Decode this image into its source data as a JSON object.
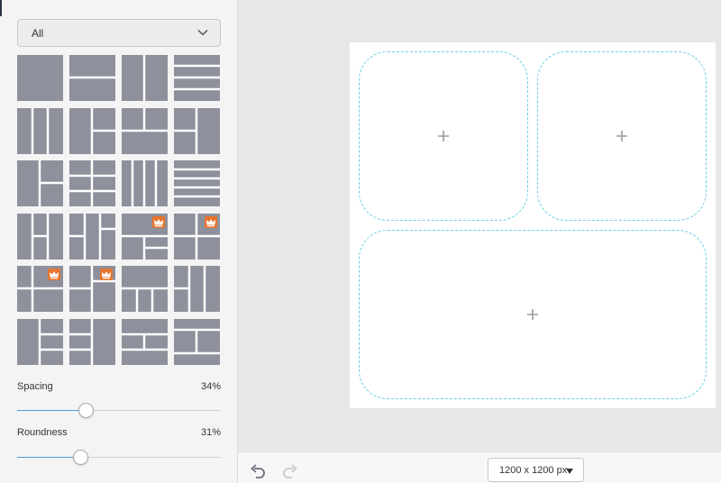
{
  "filter": {
    "selected": "All",
    "icon": "chevron-down-icon"
  },
  "layouts": [
    {
      "id": "single",
      "premium": false
    },
    {
      "id": "two-rows",
      "premium": false
    },
    {
      "id": "two-columns",
      "premium": false
    },
    {
      "id": "four-rows",
      "premium": false
    },
    {
      "id": "three-columns",
      "premium": false
    },
    {
      "id": "grid-2x2-wide-left",
      "premium": false
    },
    {
      "id": "top-split-bottom-wide",
      "premium": false
    },
    {
      "id": "left-stack-right-tall",
      "premium": false
    },
    {
      "id": "left-tall-right-stack",
      "premium": false
    },
    {
      "id": "grid-2x3",
      "premium": false
    },
    {
      "id": "four-columns",
      "premium": false
    },
    {
      "id": "five-rows",
      "premium": false
    },
    {
      "id": "columns-mixed-a",
      "premium": false
    },
    {
      "id": "columns-mixed-b",
      "premium": false
    },
    {
      "id": "top-wide-bottom-grid",
      "premium": true
    },
    {
      "id": "top-split-bottom-stack",
      "premium": true
    },
    {
      "id": "left-column-grid",
      "premium": true
    },
    {
      "id": "mixed-grid",
      "premium": true
    },
    {
      "id": "top-wide-three-bottom",
      "premium": false
    },
    {
      "id": "tall-left-grid",
      "premium": false
    },
    {
      "id": "left-tall-rows",
      "premium": false
    },
    {
      "id": "column-rows-mixed",
      "premium": false
    },
    {
      "id": "rows-split",
      "premium": false
    },
    {
      "id": "rows-grid",
      "premium": false
    }
  ],
  "premium_icon": "crown-icon",
  "spacing": {
    "label": "Spacing",
    "value_text": "34%",
    "value": 0.34
  },
  "roundness": {
    "label": "Roundness",
    "value_text": "31%",
    "value": 0.31
  },
  "canvas": {
    "cells": [
      {
        "name": "collage-cell-top-left",
        "icon": "plus-icon"
      },
      {
        "name": "collage-cell-top-right",
        "icon": "plus-icon"
      },
      {
        "name": "collage-cell-bottom",
        "icon": "plus-icon"
      }
    ]
  },
  "toolbar": {
    "undo_icon": "undo-icon",
    "redo_icon": "redo-icon",
    "size_label": "1200 x 1200 px",
    "size_icon": "caret-down-icon"
  },
  "colors": {
    "tile": "#8e919c",
    "accent": "#4a9fe0",
    "premium": "#e8742c",
    "cell_border": "#6ccfe6"
  }
}
